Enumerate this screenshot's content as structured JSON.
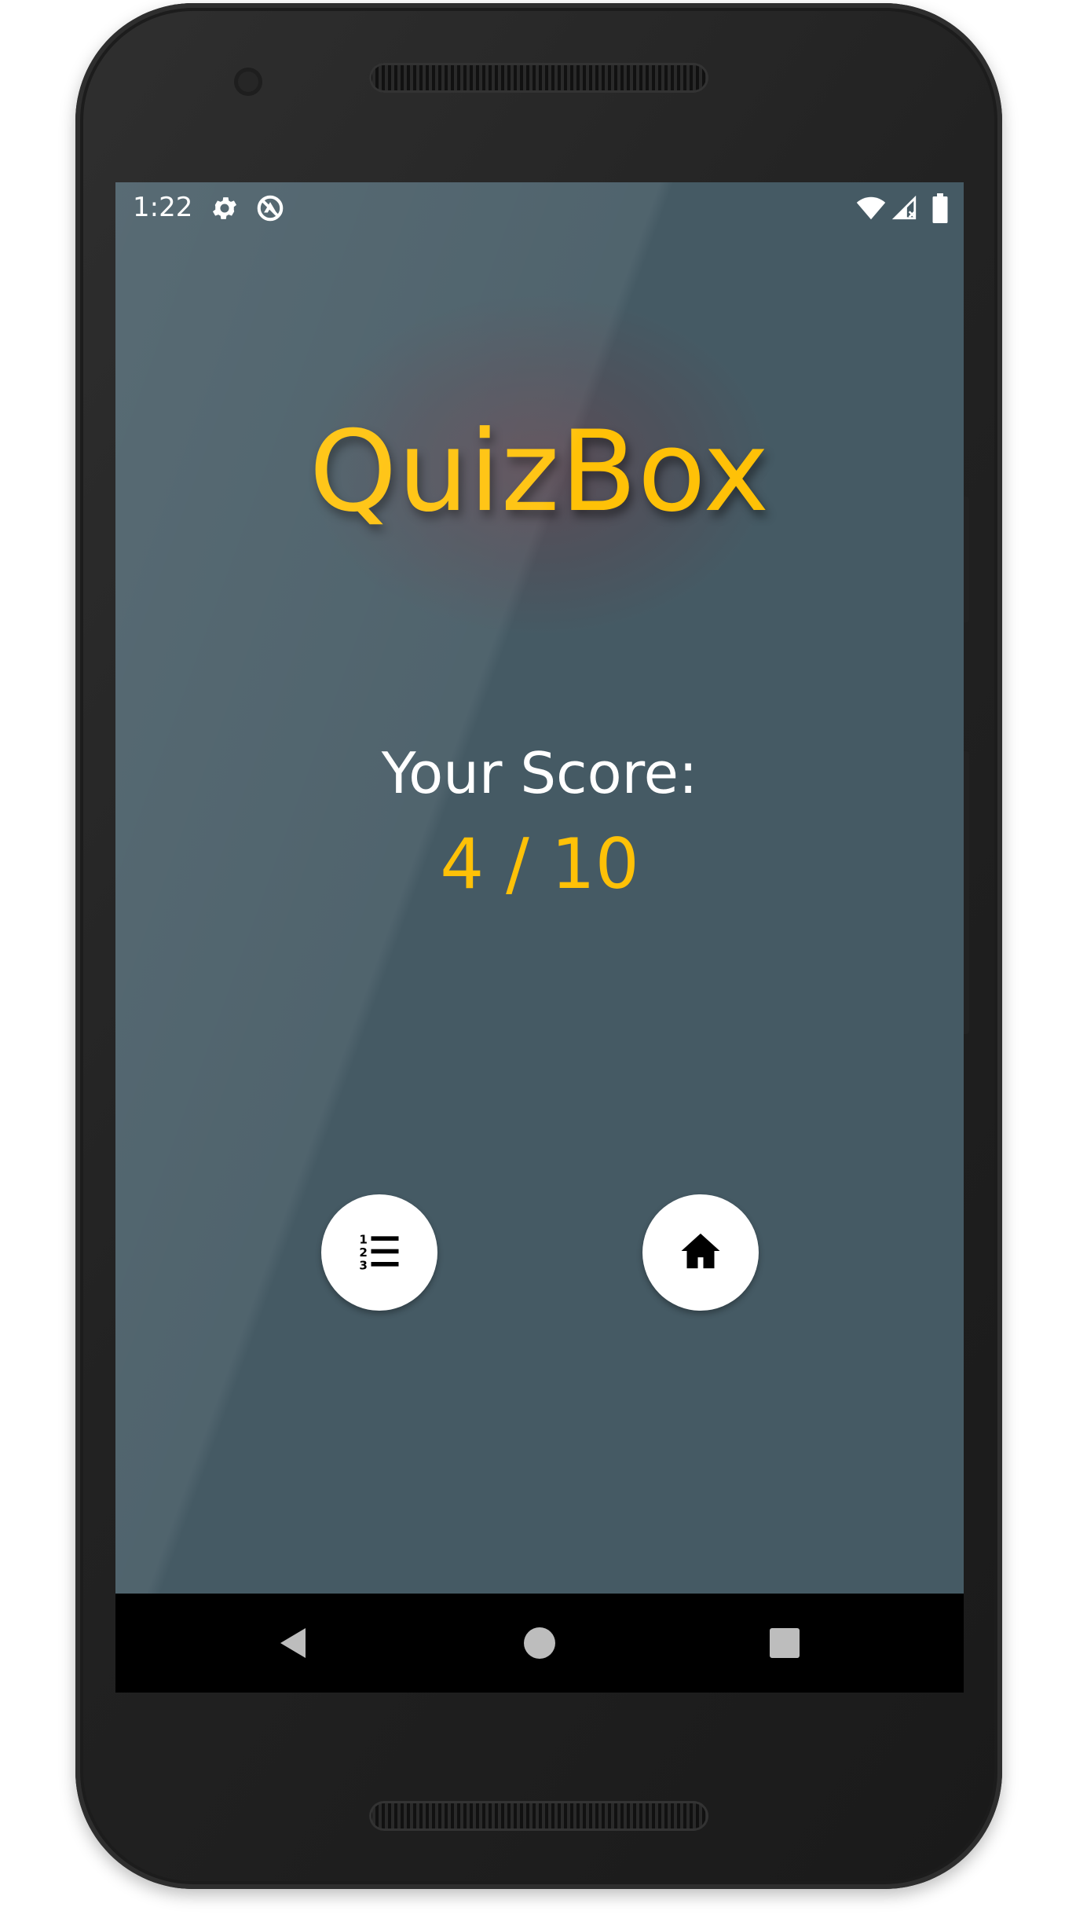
{
  "status_bar": {
    "time": "1:22",
    "icons": [
      "gear-icon",
      "sync-icon",
      "wifi-icon",
      "signal-icon",
      "battery-icon"
    ]
  },
  "app": {
    "title": "QuizBox",
    "score_label": "Your Score:",
    "score_value": "4 / 10"
  },
  "actions": {
    "leaderboard_icon": "numbered-list-icon",
    "home_icon": "home-icon"
  },
  "navigation": {
    "back_icon": "back-triangle-icon",
    "home_icon": "home-circle-icon",
    "recents_icon": "recents-square-icon"
  },
  "colors": {
    "background": "#455a64",
    "accent": "#ffc107",
    "text": "#ffffff",
    "fab": "#ffffff",
    "nav_bar": "#000000"
  }
}
